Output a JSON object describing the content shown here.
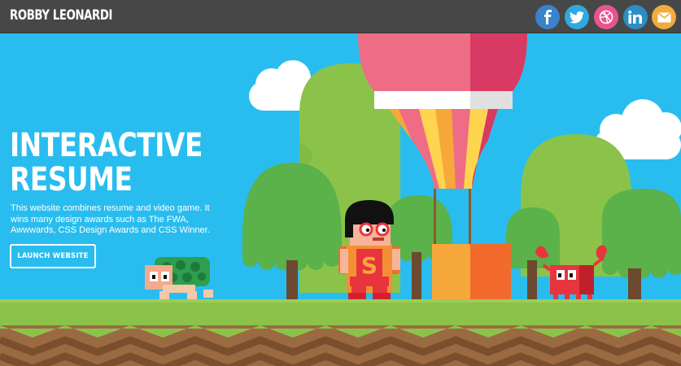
{
  "header": {
    "brand": "ROBBY LEONARDI",
    "social": [
      {
        "name": "facebook-icon",
        "color": "#3b82cc"
      },
      {
        "name": "twitter-icon",
        "color": "#30a8e0"
      },
      {
        "name": "dribbble-icon",
        "color": "#e8548f"
      },
      {
        "name": "linkedin-icon",
        "color": "#2d8dc6"
      },
      {
        "name": "mail-icon",
        "color": "#f2ab3d"
      }
    ]
  },
  "hero": {
    "title": "INTERACTIVE RESUME",
    "description": "This website combines resume and video game. It wins many design awards such as The FWA, Awwwards, CSS Design Awards and CSS Winner.",
    "button_label": "LAUNCH WEBSITE"
  },
  "colors": {
    "sky": "#29bdef",
    "grass": "#8bc34a",
    "ground": "#9b6a42",
    "topbar": "#474747"
  }
}
